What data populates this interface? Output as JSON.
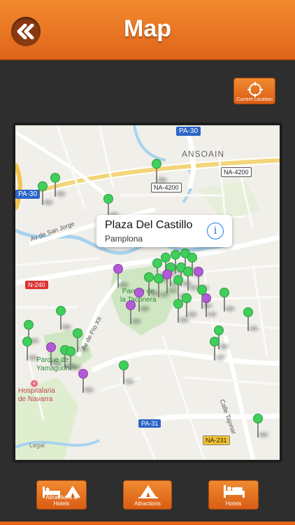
{
  "header": {
    "title": "Map",
    "back_icon": "double-chevron-left-icon"
  },
  "current_location": {
    "label": "Current Location",
    "icon": "crosshair-icon"
  },
  "map": {
    "road_labels": {
      "pa30_top": "PA-30",
      "pa30_left": "PA-30",
      "na4200_right": "NA-4200",
      "na4200_mid": "NA-4200",
      "n240": "N-240",
      "pa31": "PA-31",
      "na231": "NA-231"
    },
    "place_labels": {
      "ansoain": "ANSOAIN",
      "av_san_jorge": "Av de San Jorge",
      "parque_taconera_1": "Parque de",
      "parque_taconera_2": "la Taconera",
      "av_pio_xii": "Av de Pío XII",
      "parque_yamaguchi_1": "Parque de",
      "parque_yamaguchi_2": "Yamaguchi",
      "hospitalaria_1": "Hospitalaria",
      "hospitalaria_2": "de Navarra",
      "calle_tajonar": "Calle Tajonar",
      "legal": "Legal"
    },
    "callout": {
      "title": "Plaza Del Castillo",
      "subtitle": "Pamplona",
      "icon": "info-icon"
    }
  },
  "bottom_tabs": [
    {
      "label": "Attractions & Hotels",
      "icon": "bed-and-tent-icon"
    },
    {
      "label": "Attractions",
      "icon": "tent-icon"
    },
    {
      "label": "Hotels",
      "icon": "bed-icon"
    }
  ],
  "colors": {
    "accent": "#e8741f",
    "pin_green": "#3fcf5a",
    "pin_purple": "#b35ad8"
  }
}
